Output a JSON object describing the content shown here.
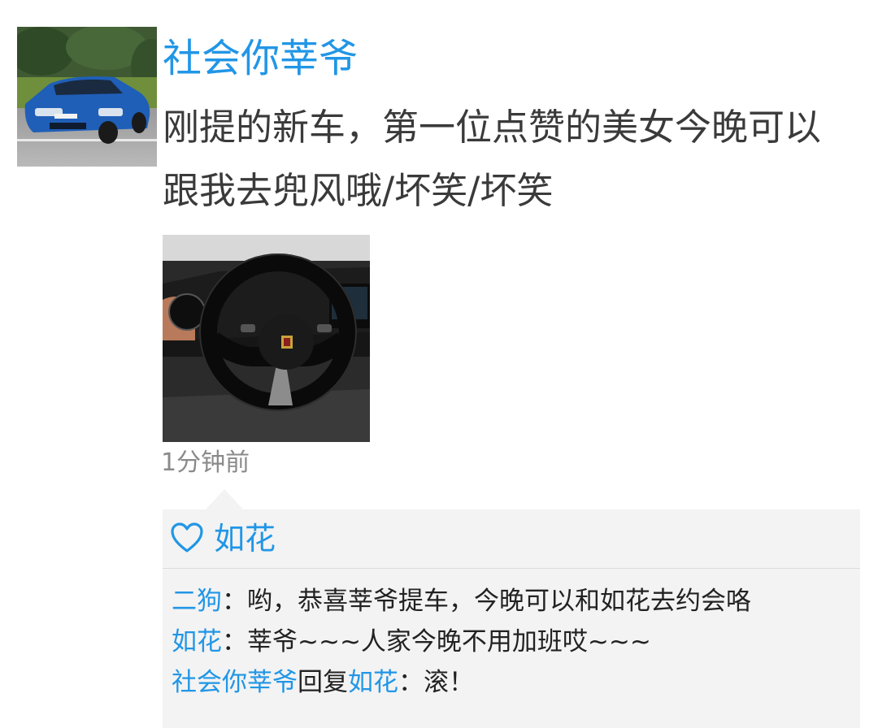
{
  "post": {
    "author": "社会你莘爷",
    "text": "刚提的新车，第一位点赞的美女今晚可以跟我去兜风哦/坏笑/坏笑",
    "time": "1分钟前",
    "avatar_image": "blue-sports-car-photo",
    "photo_image": "steering-wheel-photo"
  },
  "likes": {
    "icon": "heart-outline-icon",
    "names": "如花"
  },
  "comments": [
    {
      "author": "二狗",
      "sep": "：",
      "text": "哟，恭喜莘爷提车，今晚可以和如花去约会咯"
    },
    {
      "author": "如花",
      "sep": "：",
      "text": "莘爷~~~人家今晚不用加班哎~~~"
    },
    {
      "author": "社会你莘爷",
      "reply_word": "回复",
      "reply_to": "如花",
      "sep": "：",
      "text": "滚！"
    }
  ],
  "colors": {
    "name_blue": "#2196e6",
    "text": "#3a3a3a",
    "meta": "#8a8a8a",
    "comment_bg": "#f3f3f3"
  }
}
